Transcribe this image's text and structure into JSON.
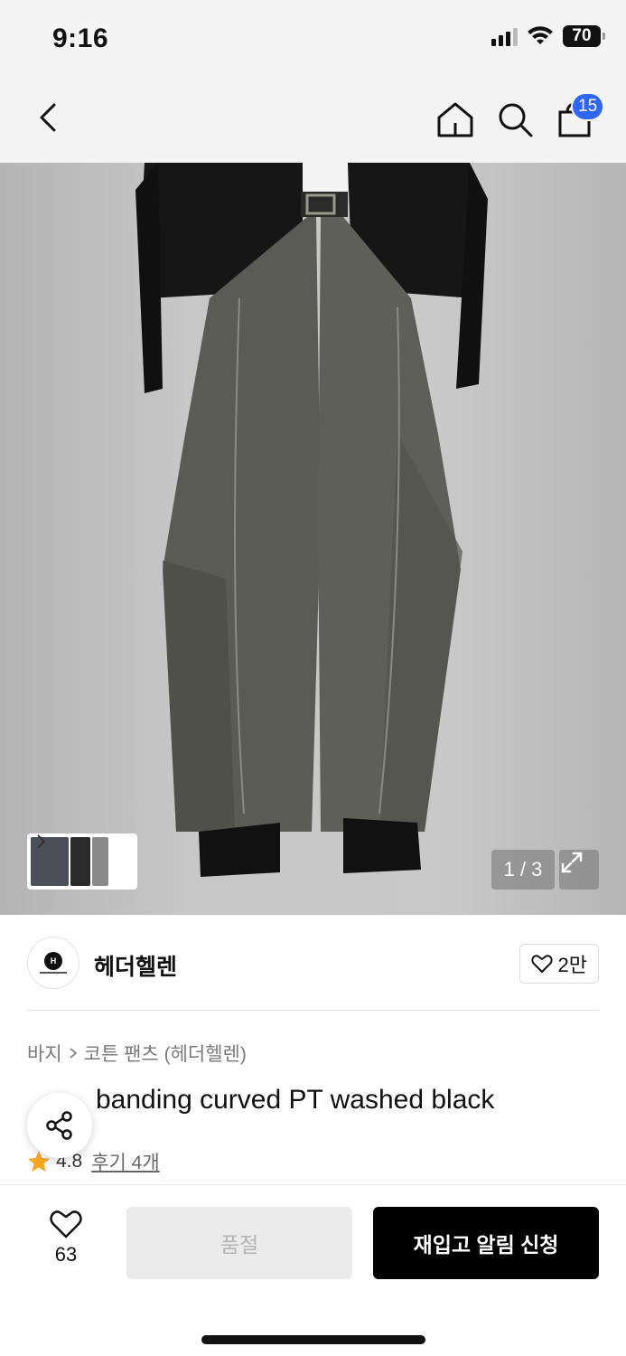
{
  "status_bar": {
    "time": "9:16",
    "battery": "70"
  },
  "nav": {
    "cart_count": "15"
  },
  "gallery": {
    "counter": "1 / 3"
  },
  "brand": {
    "name": "헤더헬렌",
    "logo_text": "HEDER HELEN",
    "likes": "2만"
  },
  "breadcrumb": {
    "category": "바지",
    "subcategory": "코튼 팬츠 (헤더헬렌)"
  },
  "product": {
    "title": "C◦◦l banding curved PT washed black",
    "title_visible_suffix": "banding curved PT washed black",
    "rating": "4.8",
    "reviews": "후기 4개"
  },
  "actions": {
    "wish_count": "63",
    "soldout_label": "품절",
    "restock_label": "재입고 알림 신청"
  },
  "colors": {
    "accent_badge": "#2f66f6",
    "star": "#f5a623",
    "primary_button": "#000000",
    "disabled_button": "#ebebeb"
  },
  "icons": [
    "back-chevron-icon",
    "home-icon",
    "search-icon",
    "shopping-bag-icon",
    "expand-icon",
    "heart-icon",
    "share-icon",
    "star-icon",
    "chevron-right-icon"
  ]
}
